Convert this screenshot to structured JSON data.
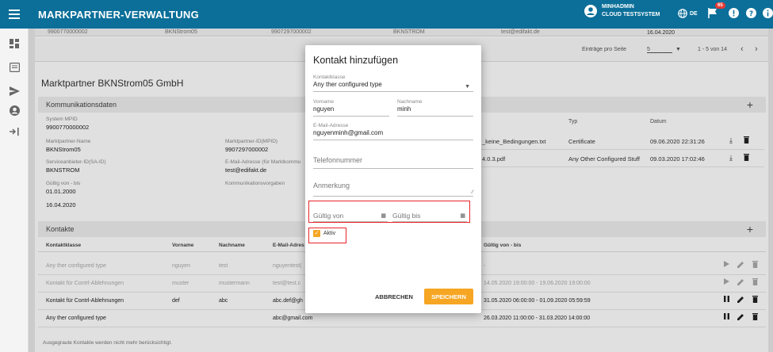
{
  "header": {
    "app_title": "MARKPARTNER-VERWALTUNG",
    "user_name": "MINHADMIN",
    "user_system": "CLOUD TESTSYSTEM",
    "lang": "DE",
    "notif_count": "65"
  },
  "behind_strip": {
    "c1": "9900770000002",
    "c2": "BKNStrom05",
    "c3": "9907297000002",
    "c4": "BKNSTROM",
    "c5": "test@edifakt.de",
    "c6": "16.04.2020"
  },
  "pager": {
    "entries_label": "Einträge pro Seite",
    "entries_value": "5",
    "range": "1 - 5 von 14"
  },
  "marktpartner_title": "Marktpartner BKNStrom05 GmbH",
  "kommunikation": {
    "header": "Kommunikationsdaten",
    "system_mpid_label": "System MPID",
    "system_mpid": "9900770000002",
    "mp_name_label": "Marktpartner-Name",
    "mp_name": "BKNStrom05",
    "mp_id_label": "Marktpartner-ID(MPID)",
    "mp_id": "9907297000002",
    "sa_label": "Serviceanbieter-ID(SA-ID)",
    "sa_value": "BKNSTROM",
    "email_label": "E-Mail-Adresse (für Marktkommu",
    "email_value": "test@edifakt.de",
    "gueltig_label": "Gültig von - bis",
    "gueltig_from": "01.01.2000",
    "gueltig_to": "16.04.2020",
    "vorgaben_label": "Kommunikationsvorgaben"
  },
  "docs": {
    "typ_header": "Typ",
    "datum_header": "Datum",
    "rows": [
      {
        "name": "_keine_Bedingungen.txt",
        "typ": "Certificate",
        "datum": "09.06.2020 22:31:26"
      },
      {
        "name": "4.0.3.pdf",
        "typ": "Any Other Configured Stuff",
        "datum": "09.03.2020 17:02:46"
      }
    ]
  },
  "kontakte": {
    "header": "Kontakte",
    "col_klasse": "Kontaktklasse",
    "col_vorname": "Vorname",
    "col_nachname": "Nachname",
    "col_email": "E-Mail-Adres",
    "col_gueltig": "Gültig von - bis",
    "rows": [
      {
        "klasse": "Any ther configured type",
        "vorname": "nguyen",
        "nachname": "test",
        "email": "nguyentest(",
        "gueltig": "-"
      },
      {
        "klasse": "Kontakt für Contrl-Ablehnungen",
        "vorname": "muster",
        "nachname": "mustermann",
        "email": "test@test.c",
        "gueltig": "14.05.2020 19:00:00 - 19.06.2020 19:00:00"
      },
      {
        "klasse": "Kontakt für Contrl-Ablehnungen",
        "vorname": "def",
        "nachname": "abc",
        "email": "abc.def@gh",
        "gueltig": "31.05.2020 06:00:00 - 01.09.2020 05:59:59"
      },
      {
        "klasse": "Any ther configured type",
        "vorname": "",
        "nachname": "",
        "email": "abc@gmail.com",
        "gueltig": "26.03.2020 11:00:00 - 31.03.2020 14:00:00"
      }
    ],
    "footnote": "Ausgegraute Kontakte werden nicht mehr berücksichtigt."
  },
  "modal": {
    "title": "Kontakt hinzufügen",
    "klasse_label": "Kontaktklasse",
    "klasse_value": "Any ther configured type",
    "vorname_label": "Vorname",
    "vorname_value": "nguyen",
    "nachname_label": "Nachname",
    "nachname_value": "minh",
    "email_label": "E-Mail-Adresse",
    "email_value": "nguyenminh@gmail.com",
    "telefon_placeholder": "Telefonnummer",
    "anmerkung_placeholder": "Anmerkung",
    "von_placeholder": "Gültig von",
    "bis_placeholder": "Gültig bis",
    "aktiv_label": "Aktiv",
    "cancel_label": "ABBRECHEN",
    "save_label": "SPEICHERN"
  },
  "colors": {
    "header": "#0b6f99",
    "accent": "#f6a623",
    "highlight": "#e8242a"
  }
}
